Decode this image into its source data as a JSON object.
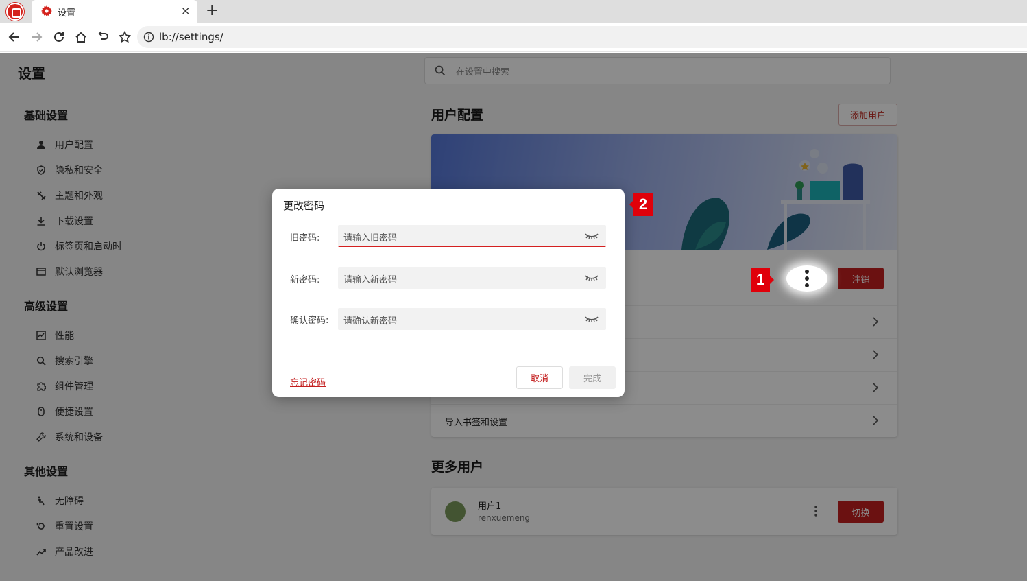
{
  "browser": {
    "tab_title": "设置",
    "tab_close": "×",
    "new_tab": "+",
    "address": "lb://settings/"
  },
  "page": {
    "title": "设置",
    "search_placeholder": "在设置中搜索"
  },
  "sidebar": {
    "sections": [
      {
        "title": "基础设置",
        "items": [
          {
            "label": "用户配置",
            "icon": "user-icon"
          },
          {
            "label": "隐私和安全",
            "icon": "shield-icon"
          },
          {
            "label": "主题和外观",
            "icon": "palette-icon"
          },
          {
            "label": "下载设置",
            "icon": "download-icon"
          },
          {
            "label": "标签页和启动时",
            "icon": "power-icon"
          },
          {
            "label": "默认浏览器",
            "icon": "browser-icon"
          }
        ]
      },
      {
        "title": "高级设置",
        "items": [
          {
            "label": "性能",
            "icon": "performance-icon"
          },
          {
            "label": "搜索引擎",
            "icon": "search-icon"
          },
          {
            "label": "组件管理",
            "icon": "puzzle-icon"
          },
          {
            "label": "便捷设置",
            "icon": "mouse-icon"
          },
          {
            "label": "系统和设备",
            "icon": "wrench-icon"
          }
        ]
      },
      {
        "title": "其他设置",
        "items": [
          {
            "label": "无障碍",
            "icon": "accessibility-icon"
          },
          {
            "label": "重置设置",
            "icon": "reset-icon"
          },
          {
            "label": "产品改进",
            "icon": "trend-icon"
          }
        ]
      }
    ]
  },
  "main": {
    "user_section_title": "用户配置",
    "add_user": "添加用户",
    "logout": "注销",
    "rows": [
      "",
      "",
      "",
      "导入书签和设置"
    ],
    "more_users_title": "更多用户",
    "users": [
      {
        "name": "用户1",
        "id": "renxuemeng",
        "action": "切换"
      }
    ]
  },
  "dialog": {
    "title": "更改密码",
    "fields": [
      {
        "label": "旧密码:",
        "placeholder": "请输入旧密码"
      },
      {
        "label": "新密码:",
        "placeholder": "请输入新密码"
      },
      {
        "label": "确认密码:",
        "placeholder": "请确认新密码"
      }
    ],
    "forgot": "忘记密码",
    "cancel": "取消",
    "done": "完成"
  },
  "markers": [
    "1",
    "2"
  ],
  "colors": {
    "accent": "#c41f1f",
    "marker": "#e0000a"
  }
}
